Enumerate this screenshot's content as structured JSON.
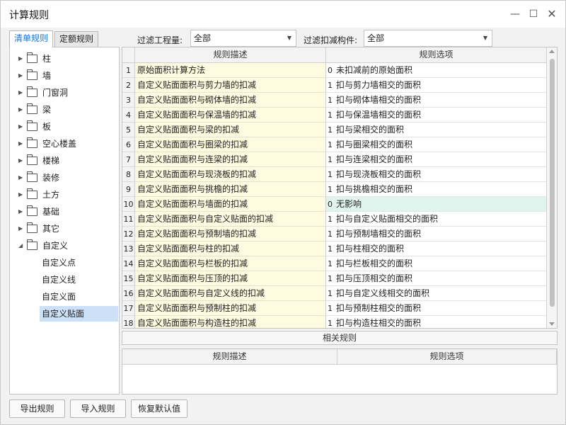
{
  "window": {
    "title": "计算规则"
  },
  "tabs": [
    {
      "label": "清单规则"
    },
    {
      "label": "定额规则"
    }
  ],
  "filters": {
    "project_label": "过滤工程量:",
    "project_value": "全部",
    "deduct_label": "过滤扣减构件:",
    "deduct_value": "全部"
  },
  "tree": {
    "nodes": [
      {
        "label": "柱"
      },
      {
        "label": "墙"
      },
      {
        "label": "门窗洞"
      },
      {
        "label": "梁"
      },
      {
        "label": "板"
      },
      {
        "label": "空心楼盖"
      },
      {
        "label": "楼梯"
      },
      {
        "label": "装修"
      },
      {
        "label": "土方"
      },
      {
        "label": "基础"
      },
      {
        "label": "其它"
      },
      {
        "label": "自定义"
      }
    ],
    "children": [
      {
        "label": "自定义点"
      },
      {
        "label": "自定义线"
      },
      {
        "label": "自定义面"
      },
      {
        "label": "自定义贴面"
      }
    ]
  },
  "grid": {
    "headers": {
      "desc": "规则描述",
      "option": "规则选项"
    },
    "rows": [
      {
        "num": "1",
        "desc": "原始面积计算方法",
        "code": "0",
        "option": "未扣减前的原始面积"
      },
      {
        "num": "2",
        "desc": "自定义贴面面积与剪力墙的扣减",
        "code": "1",
        "option": "扣与剪力墙相交的面积"
      },
      {
        "num": "3",
        "desc": "自定义贴面面积与砌体墙的扣减",
        "code": "1",
        "option": "扣与砌体墙相交的面积"
      },
      {
        "num": "4",
        "desc": "自定义贴面面积与保温墙的扣减",
        "code": "1",
        "option": "扣与保温墙相交的面积"
      },
      {
        "num": "5",
        "desc": "自定义贴面面积与梁的扣减",
        "code": "1",
        "option": "扣与梁相交的面积"
      },
      {
        "num": "6",
        "desc": "自定义贴面面积与圈梁的扣减",
        "code": "1",
        "option": "扣与圈梁相交的面积"
      },
      {
        "num": "7",
        "desc": "自定义贴面面积与连梁的扣减",
        "code": "1",
        "option": "扣与连梁相交的面积"
      },
      {
        "num": "8",
        "desc": "自定义贴面面积与现浇板的扣减",
        "code": "1",
        "option": "扣与现浇板相交的面积"
      },
      {
        "num": "9",
        "desc": "自定义贴面面积与挑檐的扣减",
        "code": "1",
        "option": "扣与挑檐相交的面积"
      },
      {
        "num": "10",
        "desc": "自定义贴面面积与墙面的扣减",
        "code": "0",
        "option": "无影响"
      },
      {
        "num": "11",
        "desc": "自定义贴面面积与自定义贴面的扣减",
        "code": "1",
        "option": "扣与自定义贴面相交的面积"
      },
      {
        "num": "12",
        "desc": "自定义贴面面积与预制墙的扣减",
        "code": "1",
        "option": "扣与预制墙相交的面积"
      },
      {
        "num": "13",
        "desc": "自定义贴面面积与柱的扣减",
        "code": "1",
        "option": "扣与柱相交的面积"
      },
      {
        "num": "14",
        "desc": "自定义贴面面积与栏板的扣减",
        "code": "1",
        "option": "扣与栏板相交的面积"
      },
      {
        "num": "15",
        "desc": "自定义贴面面积与压顶的扣减",
        "code": "1",
        "option": "扣与压顶相交的面积"
      },
      {
        "num": "16",
        "desc": "自定义贴面面积与自定义线的扣减",
        "code": "1",
        "option": "扣与自定义线相交的面积"
      },
      {
        "num": "17",
        "desc": "自定义贴面面积与预制柱的扣减",
        "code": "1",
        "option": "扣与预制柱相交的面积"
      },
      {
        "num": "18",
        "desc": "自定义贴面面积与构造柱的扣减",
        "code": "1",
        "option": "扣与构造柱相交的面积"
      }
    ]
  },
  "related": {
    "label": "相关规则"
  },
  "grid2": {
    "headers": {
      "desc": "规则描述",
      "option": "规则选项"
    }
  },
  "buttons": {
    "export": "导出规则",
    "import": "导入规则",
    "restore": "恢复默认值"
  },
  "colors": {
    "accent": "#1e6fd0",
    "desc_bg": "#fffbe0",
    "highlight_bg": "#dff5ee",
    "selected_bg": "#cce0f7"
  }
}
